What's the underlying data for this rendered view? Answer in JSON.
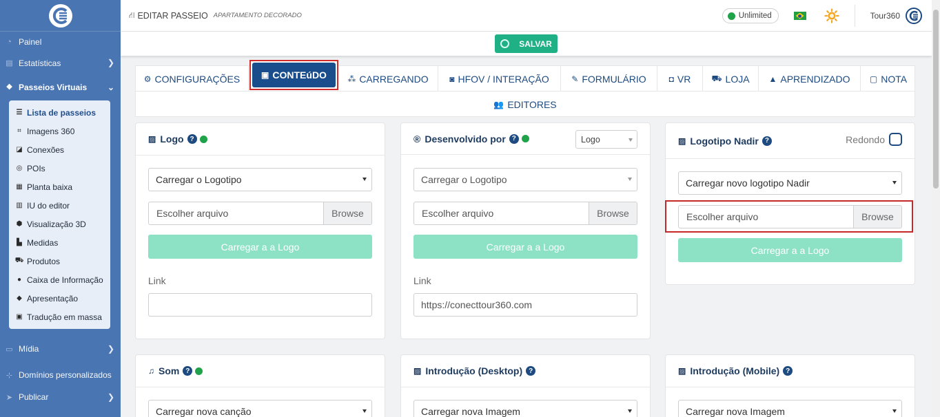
{
  "sidebar": {
    "items": [
      {
        "label": "Painel",
        "icon": "gauge-icon"
      },
      {
        "label": "Estatísticas",
        "icon": "chart-icon"
      },
      {
        "label": "Passeios Virtuais",
        "icon": "cubes-icon"
      }
    ],
    "submenu": [
      {
        "label": "Lista de passeios",
        "icon": "list-icon"
      },
      {
        "label": "Imagens 360",
        "icon": "panorama-icon"
      },
      {
        "label": "Conexões",
        "icon": "link-icon"
      },
      {
        "label": "POIs",
        "icon": "target-icon"
      },
      {
        "label": "Planta baixa",
        "icon": "map-icon"
      },
      {
        "label": "IU do editor",
        "icon": "sliders-icon"
      },
      {
        "label": "Visualização 3D",
        "icon": "cube-icon"
      },
      {
        "label": "Medidas",
        "icon": "ruler-icon"
      },
      {
        "label": "Produtos",
        "icon": "cart-icon"
      },
      {
        "label": "Caixa de Informação",
        "icon": "info-icon"
      },
      {
        "label": "Apresentação",
        "icon": "presentation-icon"
      },
      {
        "label": "Tradução em massa",
        "icon": "language-icon"
      }
    ],
    "bottom": [
      {
        "label": "Mídia",
        "icon": "desktop-icon"
      },
      {
        "label": "Domínios personalizados",
        "icon": "sitemap-icon"
      },
      {
        "label": "Publicar",
        "icon": "paper-plane-icon"
      }
    ]
  },
  "header": {
    "title": "EDITAR PASSEIO",
    "subtitle": "APARTAMENTO DECORADO",
    "plan": "Unlimited",
    "user": "Tour360"
  },
  "save_label": "SALVAR",
  "tabs": [
    {
      "label": "CONFIGURAÇÕES",
      "icon": "gears-icon"
    },
    {
      "label": "CONTEúDO",
      "icon": "images-icon"
    },
    {
      "label": "CARREGANDO",
      "icon": "spinner-icon"
    },
    {
      "label": "HFOV / INTERAÇÃO",
      "icon": "binoculars-icon"
    },
    {
      "label": "FORMULÁRIO",
      "icon": "edit-icon"
    },
    {
      "label": "VR",
      "icon": "vr-icon"
    },
    {
      "label": "LOJA",
      "icon": "cart-icon"
    },
    {
      "label": "APRENDIZADO",
      "icon": "graduation-icon"
    },
    {
      "label": "NOTA",
      "icon": "note-icon"
    }
  ],
  "tab_editors": "EDITORES",
  "cards": {
    "logo": {
      "title": "Logo",
      "select": "Carregar o Logotipo",
      "file_placeholder": "Escolher arquivo",
      "browse": "Browse",
      "upload": "Carregar a a Logo",
      "link_label": "Link",
      "link_value": ""
    },
    "developed": {
      "title": "Desenvolvido por",
      "mode": "Logo",
      "select": "Carregar o Logotipo",
      "file_placeholder": "Escolher arquivo",
      "browse": "Browse",
      "upload": "Carregar a a Logo",
      "link_label": "Link",
      "link_value": "https://conecttour360.com"
    },
    "nadir": {
      "title": "Logotipo Nadir",
      "round_label": "Redondo",
      "select": "Carregar novo logotipo Nadir",
      "file_placeholder": "Escolher arquivo",
      "browse": "Browse",
      "upload": "Carregar a a Logo"
    },
    "sound": {
      "title": "Som",
      "select": "Carregar nova canção"
    },
    "intro_desktop": {
      "title": "Introdução (Desktop)",
      "select": "Carregar nova Imagem"
    },
    "intro_mobile": {
      "title": "Introdução (Mobile)",
      "select": "Carregar nova Imagem"
    }
  },
  "colors": {
    "primary": "#1a4d8c",
    "sidebar": "#4a75b3",
    "success": "#1fb085",
    "upload_disabled": "#8de2c5",
    "highlight": "#c62828"
  }
}
